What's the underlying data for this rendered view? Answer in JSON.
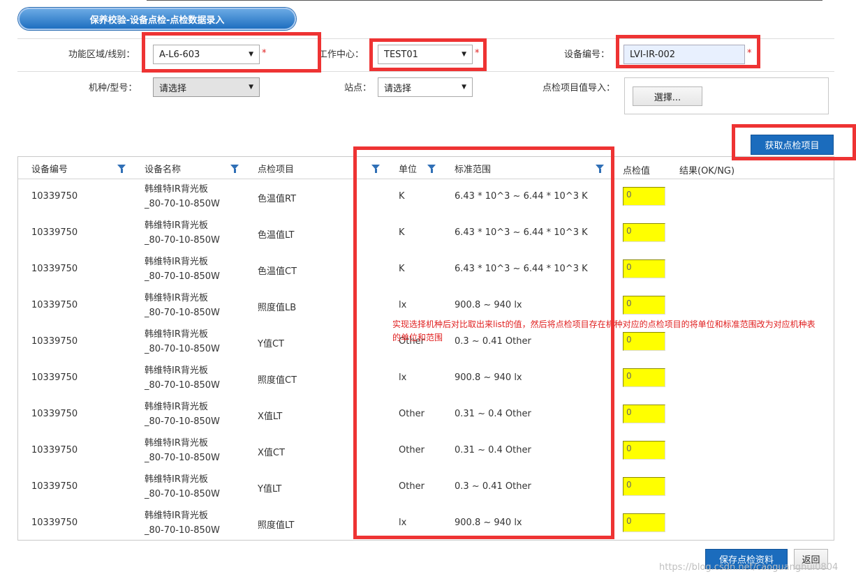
{
  "page": {
    "title": "保养校验-设备点检-点检数据录入"
  },
  "form": {
    "area_label": "功能区域/线别：",
    "area_value": "A-L6-603",
    "work_center_label": "工作中心：",
    "work_center_value": "TEST01",
    "equipment_no_label": "设备编号：",
    "equipment_no_value": "LVI-IR-002",
    "model_label": "机种/型号：",
    "model_value": "请选择",
    "station_label": "站点：",
    "station_value": "请选择",
    "import_label": "点检项目值导入：",
    "choose_label": "選擇...",
    "required_mark": "*"
  },
  "actions": {
    "fetch_items": "获取点检项目",
    "save": "保存点检资料",
    "back": "返回"
  },
  "table": {
    "headers": [
      "设备编号",
      "设备名称",
      "点检项目",
      "单位",
      "标准范围",
      "点检值",
      "结果(OK/NG)"
    ],
    "rows": [
      {
        "equip_no": "10339750",
        "name1": "韩维特IR背光板",
        "name2": "_80-70-10-850W",
        "item": "色温值RT",
        "unit": "K",
        "range": "6.43 * 10^3 ~ 6.44 * 10^3 K",
        "value": "0"
      },
      {
        "equip_no": "10339750",
        "name1": "韩维特IR背光板",
        "name2": "_80-70-10-850W",
        "item": "色温值LT",
        "unit": "K",
        "range": "6.43 * 10^3 ~ 6.44 * 10^3 K",
        "value": "0"
      },
      {
        "equip_no": "10339750",
        "name1": "韩维特IR背光板",
        "name2": "_80-70-10-850W",
        "item": "色温值CT",
        "unit": "K",
        "range": "6.43 * 10^3 ~ 6.44 * 10^3 K",
        "value": "0"
      },
      {
        "equip_no": "10339750",
        "name1": "韩维特IR背光板",
        "name2": "_80-70-10-850W",
        "item": "照度值LB",
        "unit": "lx",
        "range": "900.8 ~ 940 lx",
        "value": "0"
      },
      {
        "equip_no": "10339750",
        "name1": "韩维特IR背光板",
        "name2": "_80-70-10-850W",
        "item": "Y值CT",
        "unit": "Other",
        "range": "0.3 ~ 0.41 Other",
        "value": "0"
      },
      {
        "equip_no": "10339750",
        "name1": "韩维特IR背光板",
        "name2": "_80-70-10-850W",
        "item": "照度值CT",
        "unit": "lx",
        "range": "900.8 ~ 940 lx",
        "value": "0"
      },
      {
        "equip_no": "10339750",
        "name1": "韩维特IR背光板",
        "name2": "_80-70-10-850W",
        "item": "X值LT",
        "unit": "Other",
        "range": "0.31 ~ 0.4 Other",
        "value": "0"
      },
      {
        "equip_no": "10339750",
        "name1": "韩维特IR背光板",
        "name2": "_80-70-10-850W",
        "item": "X值CT",
        "unit": "Other",
        "range": "0.31 ~ 0.4 Other",
        "value": "0"
      },
      {
        "equip_no": "10339750",
        "name1": "韩维特IR背光板",
        "name2": "_80-70-10-850W",
        "item": "Y值LT",
        "unit": "Other",
        "range": "0.3 ~ 0.41 Other",
        "value": "0"
      },
      {
        "equip_no": "10339750",
        "name1": "韩维特IR背光板",
        "name2": "_80-70-10-850W",
        "item": "照度值LT",
        "unit": "lx",
        "range": "900.8 ~ 940 lx",
        "value": "0"
      }
    ]
  },
  "annotation": {
    "line1": "实现选择机种后对比取出来list的值，然后将点检项目存在机种对应的点检项目的将单位和标准范围改为对应机种表",
    "line2": "的单位和范围"
  },
  "watermark": "https://blog.csdn.net/caoguanghui0804",
  "icons": {
    "dropdown": "caret-down-icon",
    "filter": "filter-icon"
  },
  "colors": {
    "highlight_border": "#ee3333",
    "primary_button": "#1b6cbd",
    "value_input": "#ffff00",
    "required": "#e02020"
  }
}
